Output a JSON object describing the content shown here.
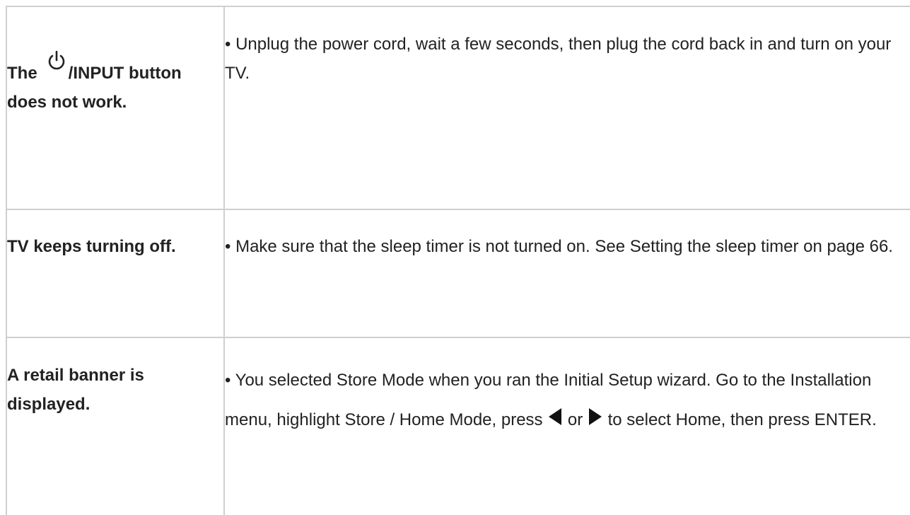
{
  "rows": [
    {
      "problem_pre": "The",
      "problem_icon": "power-icon",
      "problem_post": "/INPUT button does not work.",
      "solution": "• Unplug the power cord, wait a few seconds, then plug the cord back in and turn on your TV."
    },
    {
      "problem": "TV keeps turning off.",
      "solution": "• Make sure that the sleep timer is not turned on. See Setting the sleep timer on page 66."
    },
    {
      "problem": "A retail banner is displayed.",
      "solution_part1": "• You selected Store Mode when you ran the Initial Setup wizard. Go to the Installation menu, highlight Store / Home Mode, press",
      "solution_icon_left": "left-arrow-icon",
      "solution_part2": "or",
      "solution_icon_right": "right-arrow-icon",
      "solution_part3": "to select Home, then press ENTER."
    }
  ]
}
